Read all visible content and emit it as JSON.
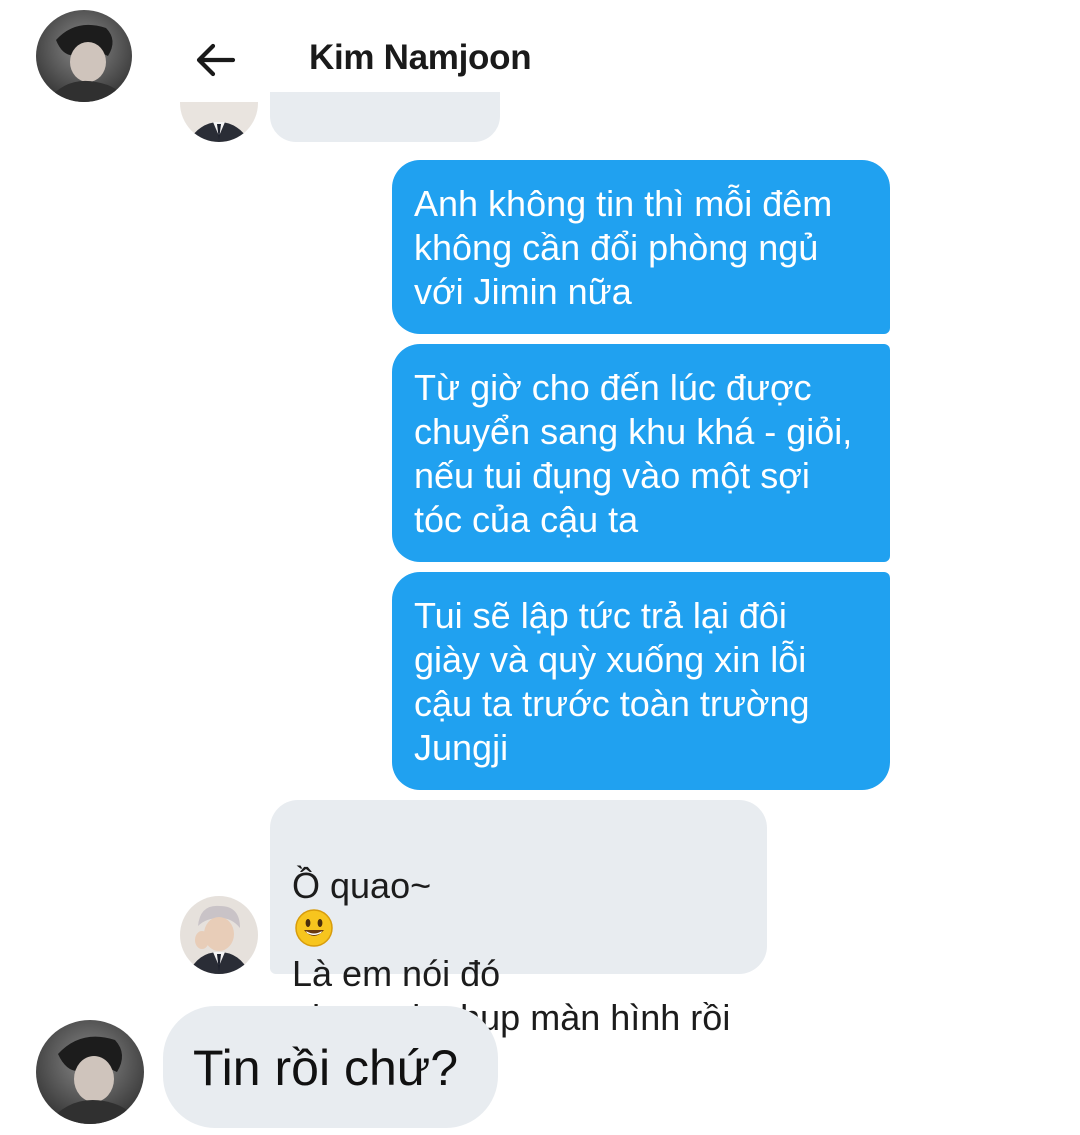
{
  "header": {
    "title": "Kim Namjoon",
    "back_icon": "arrow-left-icon"
  },
  "colors": {
    "outgoing_bubble": "#20a1f0",
    "incoming_bubble": "#e8ecf0",
    "background": "#ffffff"
  },
  "messages": [
    {
      "direction": "in",
      "text": ""
    },
    {
      "direction": "out",
      "text": "Anh không tin thì mỗi đêm\nkhông cần đổi phòng ngủ\nvới Jimin nữa"
    },
    {
      "direction": "out",
      "text": "Từ giờ cho đến lúc được\nchuyển sang khu khá - giỏi,\nnếu tui đụng vào một sợi\ntóc của cậu ta"
    },
    {
      "direction": "out",
      "text": "Tui sẽ lập tức trả lại đôi\ngiày và quỳ xuống xin lỗi\ncậu ta trước toàn trường\nJungji"
    },
    {
      "direction": "in",
      "text_before_emoji": "Ồ quao~",
      "emoji": "smiley-emoji",
      "text_after_emoji": "Là em nói đó\nnha, anh chụp màn hình rồi\nnhá!"
    }
  ],
  "reply_preview": {
    "text": "Tin rồi chứ?"
  }
}
